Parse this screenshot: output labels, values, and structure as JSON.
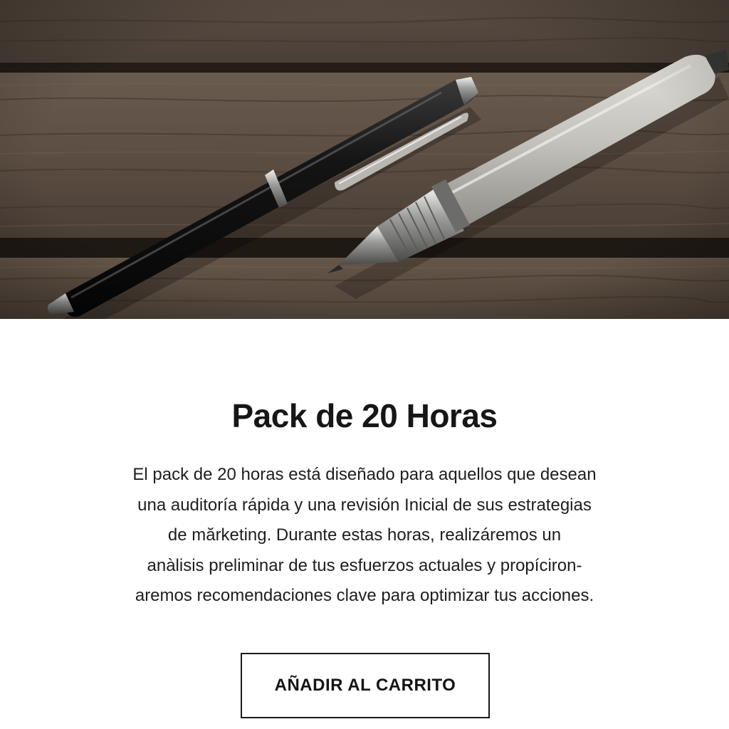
{
  "product": {
    "title": "Pack de 20 Horas",
    "description_lines": [
      "El pack de 20 horas está diseñado para aquellos que desean",
      "una auditoría rápida y una revisión Inicial de sus estrategias",
      "de mărketing. Durante estas horas, realizáremos un",
      "anàlisis preliminar de tus esfuerzos actuales y propíciron-",
      "aremos recomendaciones clave para optimizar tus acciones."
    ],
    "cta_label": "AÑADIR AL CARRITO"
  },
  "hero_image": {
    "subject": "two pens on a wooden table",
    "colors": {
      "wood_dark": "#3b312a",
      "wood_mid": "#5e5146",
      "black_pen": "#151515",
      "silver_pen": "#c9c7c1"
    }
  }
}
